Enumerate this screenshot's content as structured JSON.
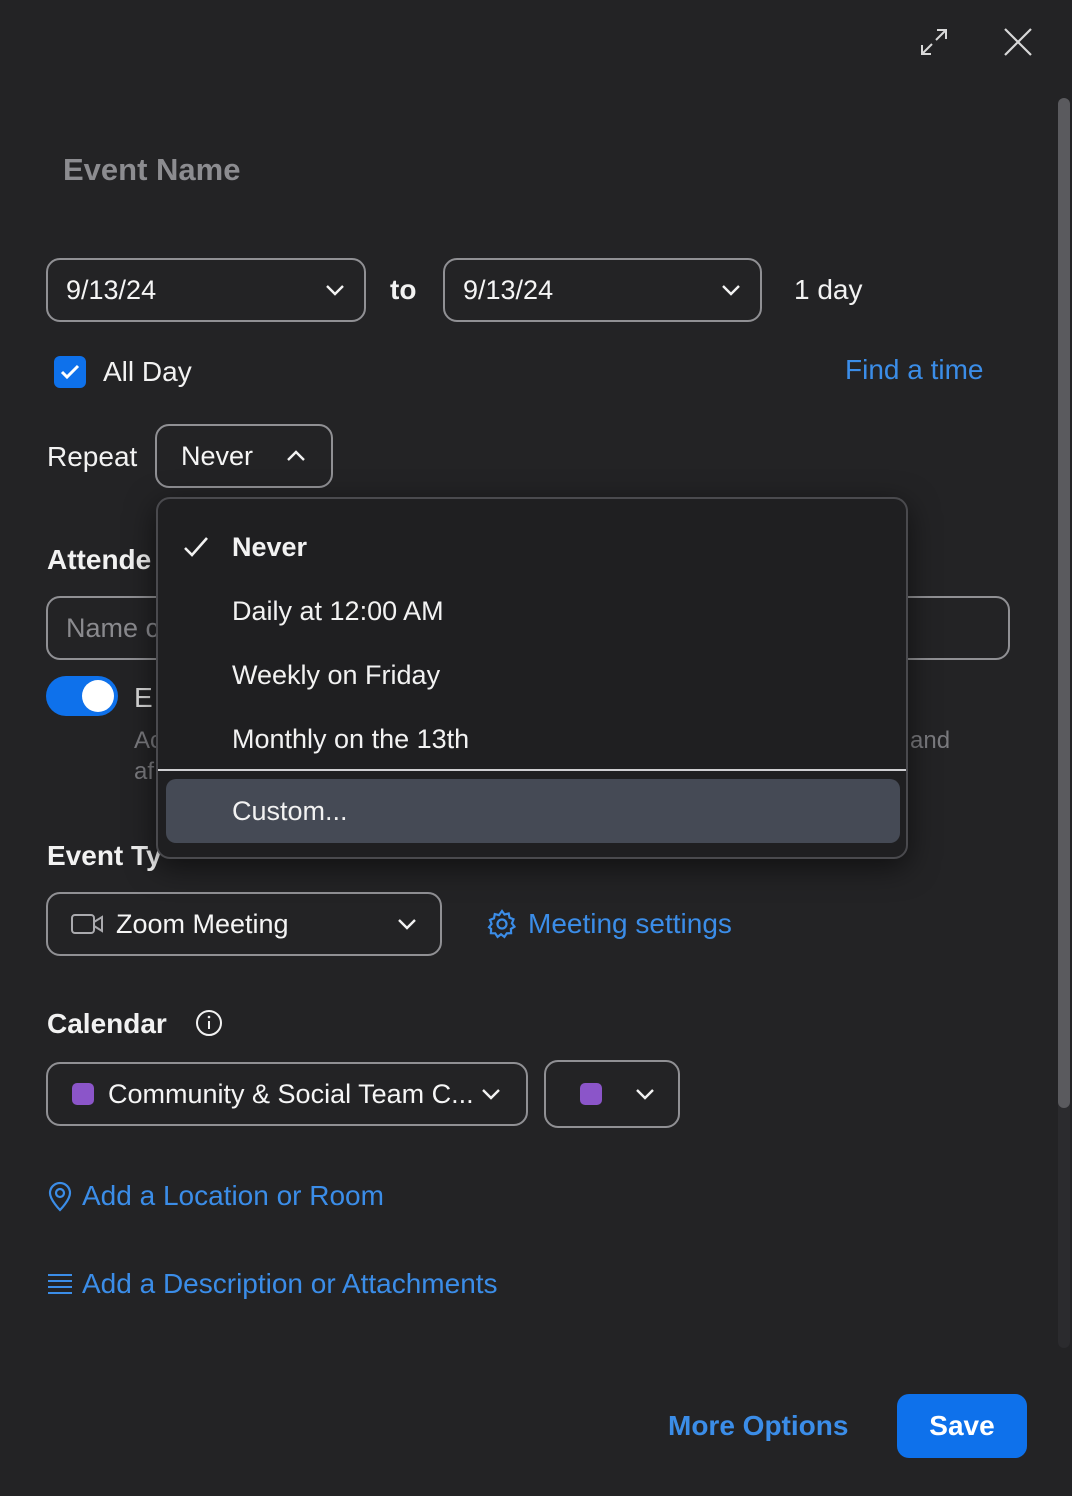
{
  "header": {
    "expand_icon": "expand-icon",
    "close_icon": "close-icon"
  },
  "event_name": {
    "placeholder": "Event Name"
  },
  "dates": {
    "start": "9/13/24",
    "separator": "to",
    "end": "9/13/24",
    "duration": "1 day"
  },
  "all_day": {
    "label": "All Day",
    "checked": true
  },
  "find_time": "Find a time",
  "repeat": {
    "label": "Repeat",
    "value": "Never",
    "options": [
      {
        "label": "Never",
        "selected": true
      },
      {
        "label": "Daily at 12:00 AM"
      },
      {
        "label": "Weekly on Friday"
      },
      {
        "label": "Monthly on the 13th"
      },
      {
        "label": "Custom..."
      }
    ]
  },
  "attendees": {
    "label_visible": "Attende",
    "input_placeholder_visible": "Name c",
    "toggle_on": true,
    "toggle_label_visible": "E",
    "desc_line1_left": "Ac",
    "desc_line1_right": "and",
    "desc_line2_left": "af"
  },
  "event_type": {
    "label_visible": "Event Ty",
    "value": "Zoom Meeting",
    "settings_link": "Meeting settings"
  },
  "calendar": {
    "label": "Calendar",
    "value": "Community & Social Team C...",
    "color": "#8b55c9"
  },
  "location_link": "Add a Location or Room",
  "description_link": "Add a Description or Attachments",
  "footer": {
    "more_options": "More Options",
    "save": "Save"
  },
  "colors": {
    "accent": "#0e71eb",
    "link": "#3b8de8",
    "background": "#232325"
  }
}
